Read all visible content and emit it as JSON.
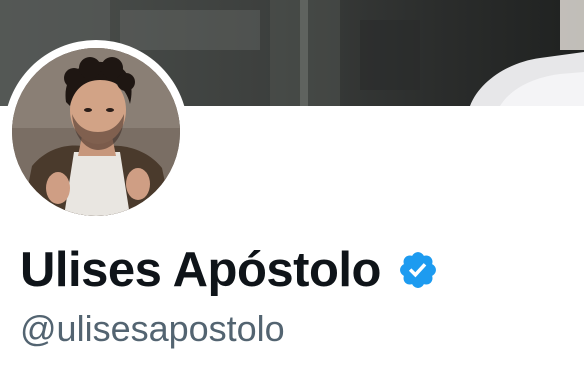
{
  "profile": {
    "display_name": "Ulises Apóstolo",
    "handle": "@ulisesapostolo",
    "verified": true
  },
  "icons": {
    "verified": "verified-badge-icon",
    "avatar": "profile-photo",
    "banner": "header-photo"
  },
  "colors": {
    "name": "#0f1419",
    "handle": "#536471",
    "verified_badge": "#1d9bf0",
    "background": "#ffffff"
  }
}
